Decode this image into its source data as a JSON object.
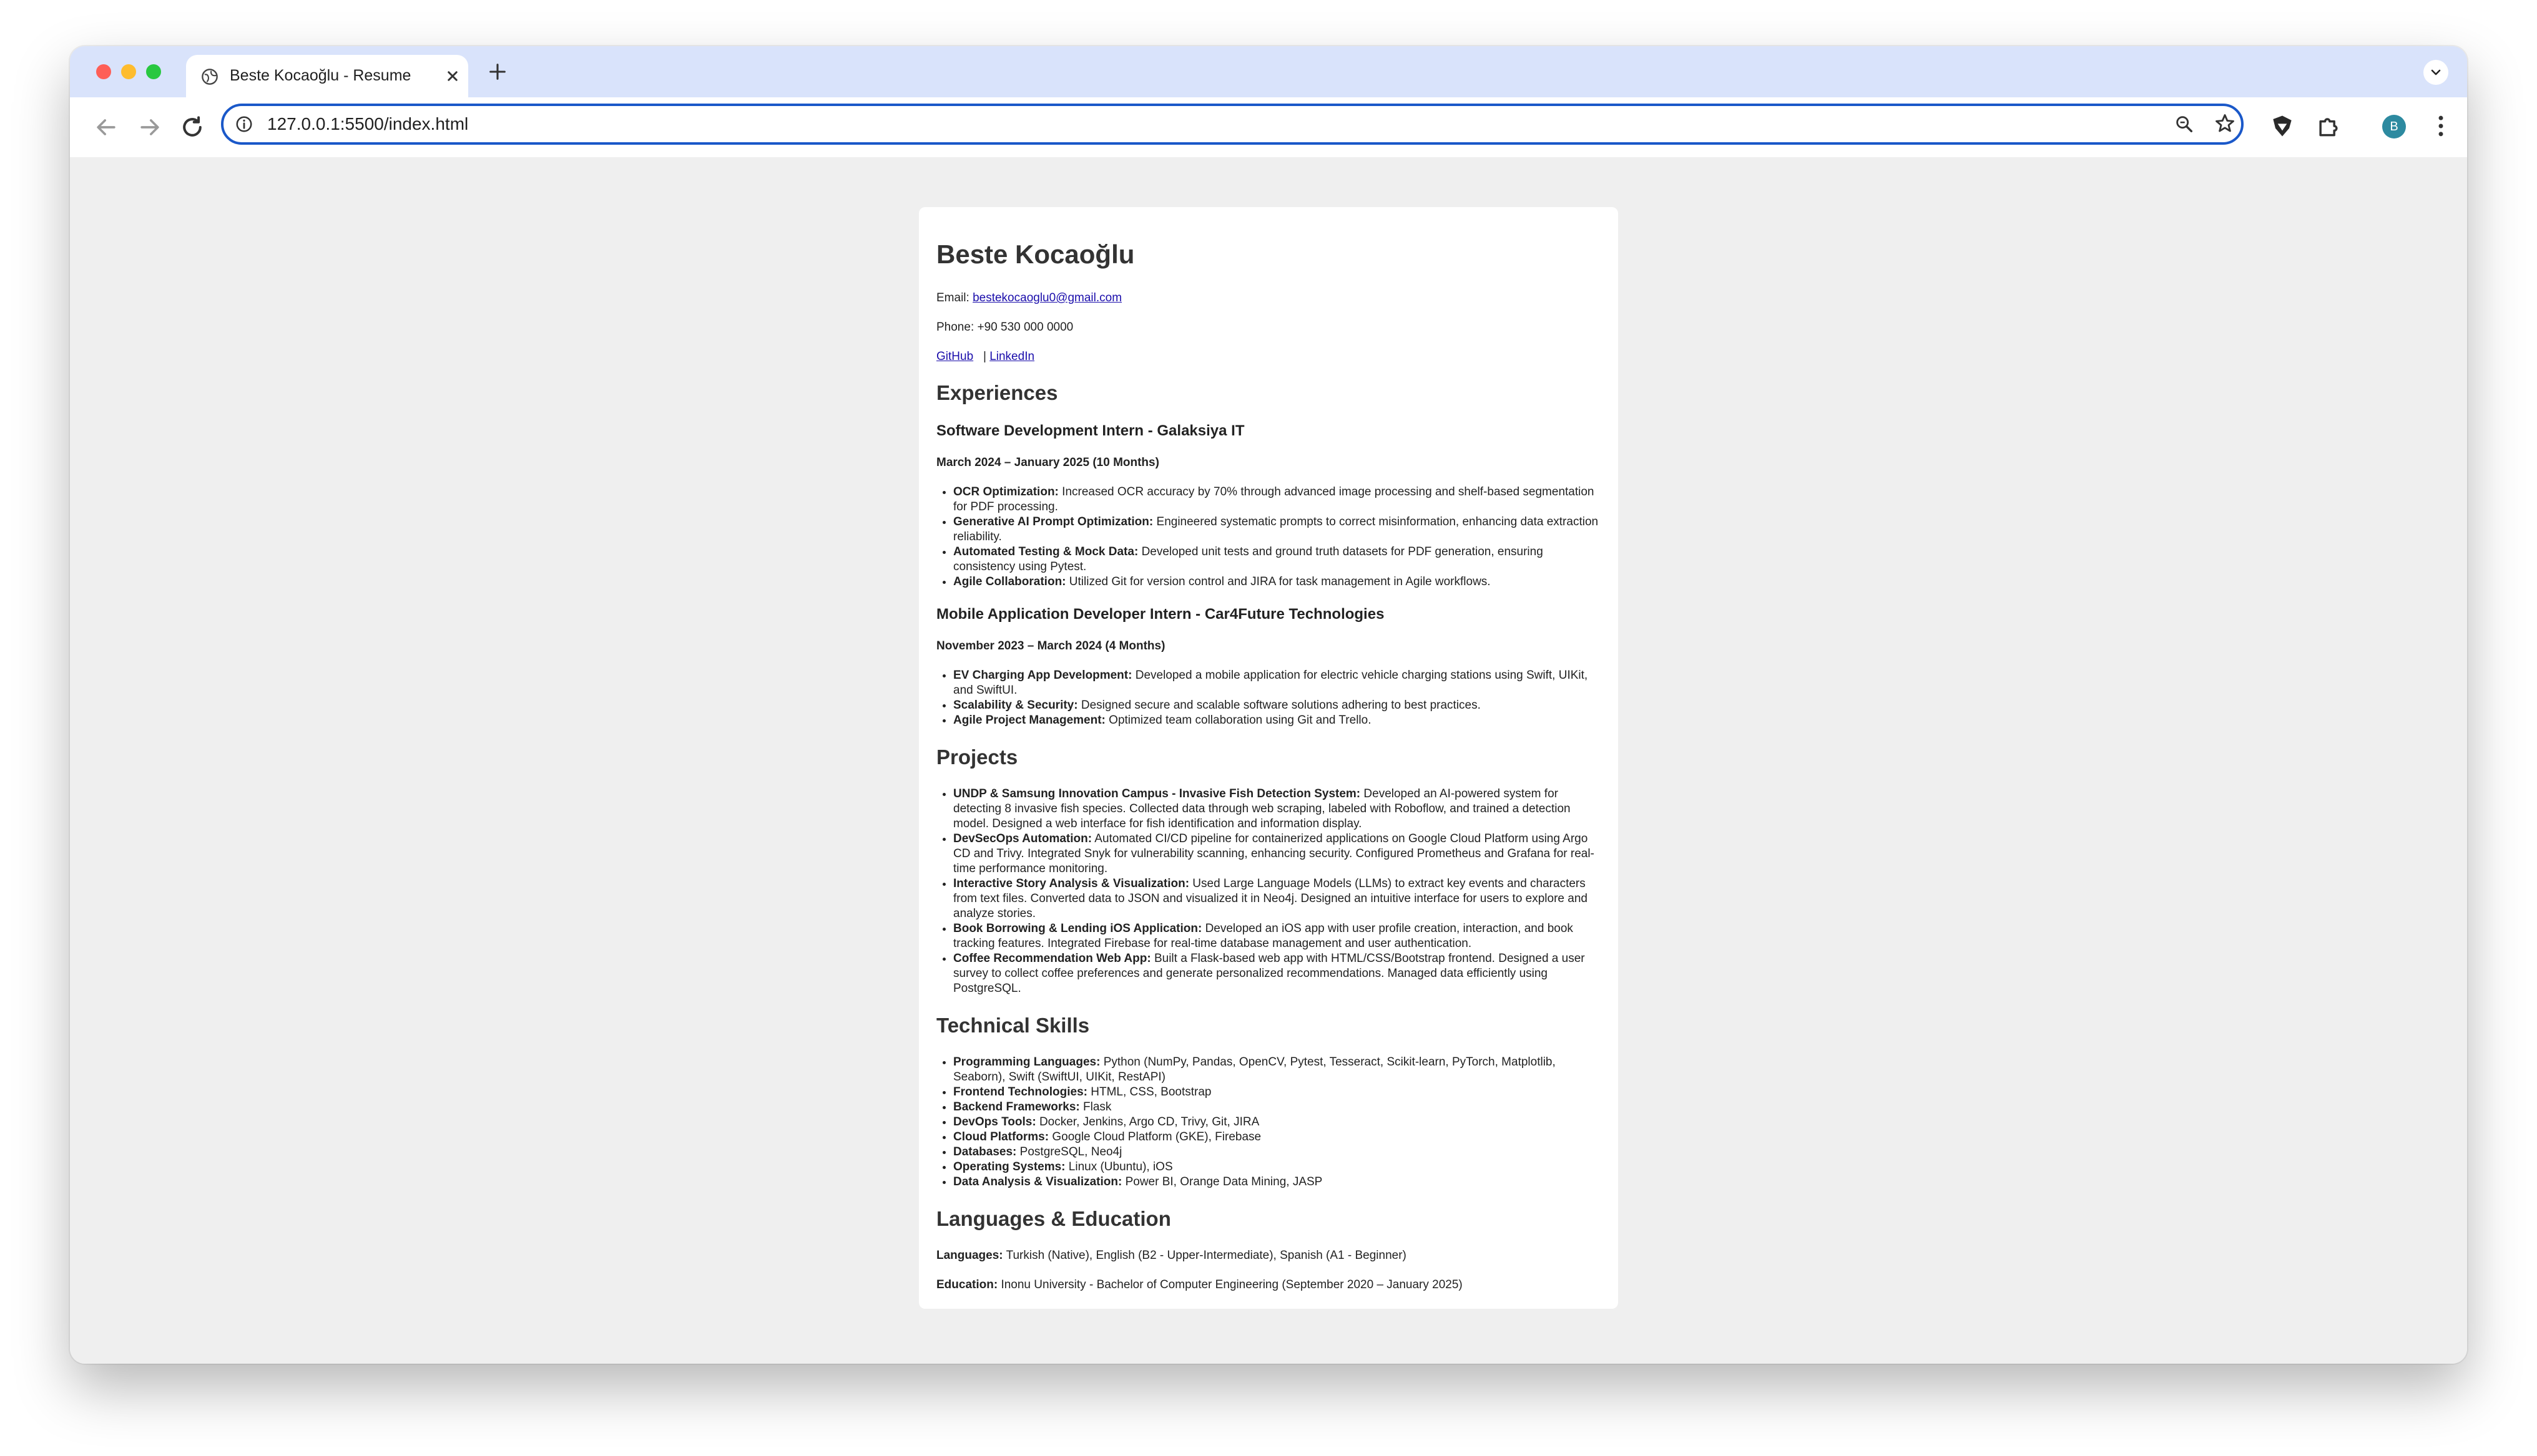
{
  "browser": {
    "tab_title": "Beste Kocaoğlu - Resume",
    "url": "127.0.0.1:5500/index.html",
    "profile_initial": "B"
  },
  "resume": {
    "name": "Beste Kocaoğlu",
    "email_label": "Email:",
    "email": "bestekocaoglu0@gmail.com",
    "phone_line": "Phone: +90 530 000 0000",
    "github_label": "GitHub",
    "link_separator": "|",
    "linkedin_label": "LinkedIn",
    "experiences_heading": "Experiences",
    "experiences": [
      {
        "title": "Software Development Intern - Galaksiya IT",
        "dates": "March 2024 – January 2025 (10 Months)",
        "items": [
          {
            "label": "OCR Optimization:",
            "text": "Increased OCR accuracy by 70% through advanced image processing and shelf-based segmentation for PDF processing."
          },
          {
            "label": "Generative AI Prompt Optimization:",
            "text": "Engineered systematic prompts to correct misinformation, enhancing data extraction reliability."
          },
          {
            "label": "Automated Testing & Mock Data:",
            "text": "Developed unit tests and ground truth datasets for PDF generation, ensuring consistency using Pytest."
          },
          {
            "label": "Agile Collaboration:",
            "text": "Utilized Git for version control and JIRA for task management in Agile workflows."
          }
        ]
      },
      {
        "title": "Mobile Application Developer Intern - Car4Future Technologies",
        "dates": "November 2023 – March 2024 (4 Months)",
        "items": [
          {
            "label": "EV Charging App Development:",
            "text": "Developed a mobile application for electric vehicle charging stations using Swift, UIKit, and SwiftUI."
          },
          {
            "label": "Scalability & Security:",
            "text": "Designed secure and scalable software solutions adhering to best practices."
          },
          {
            "label": "Agile Project Management:",
            "text": "Optimized team collaboration using Git and Trello."
          }
        ]
      }
    ],
    "projects_heading": "Projects",
    "projects": [
      {
        "label": "UNDP & Samsung Innovation Campus - Invasive Fish Detection System:",
        "text": "Developed an AI-powered system for detecting 8 invasive fish species. Collected data through web scraping, labeled with Roboflow, and trained a detection model. Designed a web interface for fish identification and information display."
      },
      {
        "label": "DevSecOps Automation:",
        "text": "Automated CI/CD pipeline for containerized applications on Google Cloud Platform using Argo CD and Trivy. Integrated Snyk for vulnerability scanning, enhancing security. Configured Prometheus and Grafana for real-time performance monitoring."
      },
      {
        "label": "Interactive Story Analysis & Visualization:",
        "text": "Used Large Language Models (LLMs) to extract key events and characters from text files. Converted data to JSON and visualized it in Neo4j. Designed an intuitive interface for users to explore and analyze stories."
      },
      {
        "label": "Book Borrowing & Lending iOS Application:",
        "text": "Developed an iOS app with user profile creation, interaction, and book tracking features. Integrated Firebase for real-time database management and user authentication."
      },
      {
        "label": "Coffee Recommendation Web App:",
        "text": "Built a Flask-based web app with HTML/CSS/Bootstrap frontend. Designed a user survey to collect coffee preferences and generate personalized recommendations. Managed data efficiently using PostgreSQL."
      }
    ],
    "skills_heading": "Technical Skills",
    "skills": [
      {
        "label": "Programming Languages:",
        "text": "Python (NumPy, Pandas, OpenCV, Pytest, Tesseract, Scikit-learn, PyTorch, Matplotlib, Seaborn), Swift (SwiftUI, UIKit, RestAPI)"
      },
      {
        "label": "Frontend Technologies:",
        "text": "HTML, CSS, Bootstrap"
      },
      {
        "label": "Backend Frameworks:",
        "text": "Flask"
      },
      {
        "label": "DevOps Tools:",
        "text": "Docker, Jenkins, Argo CD, Trivy, Git, JIRA"
      },
      {
        "label": "Cloud Platforms:",
        "text": "Google Cloud Platform (GKE), Firebase"
      },
      {
        "label": "Databases:",
        "text": "PostgreSQL, Neo4j"
      },
      {
        "label": "Operating Systems:",
        "text": "Linux (Ubuntu), iOS"
      },
      {
        "label": "Data Analysis & Visualization:",
        "text": "Power BI, Orange Data Mining, JASP"
      }
    ],
    "langedu_heading": "Languages & Education",
    "languages_label": "Languages:",
    "languages_text": "Turkish (Native), English (B2 - Upper-Intermediate), Spanish (A1 - Beginner)",
    "education_label": "Education:",
    "education_text": "Inonu University - Bachelor of Computer Engineering (September 2020 – January 2025)"
  }
}
